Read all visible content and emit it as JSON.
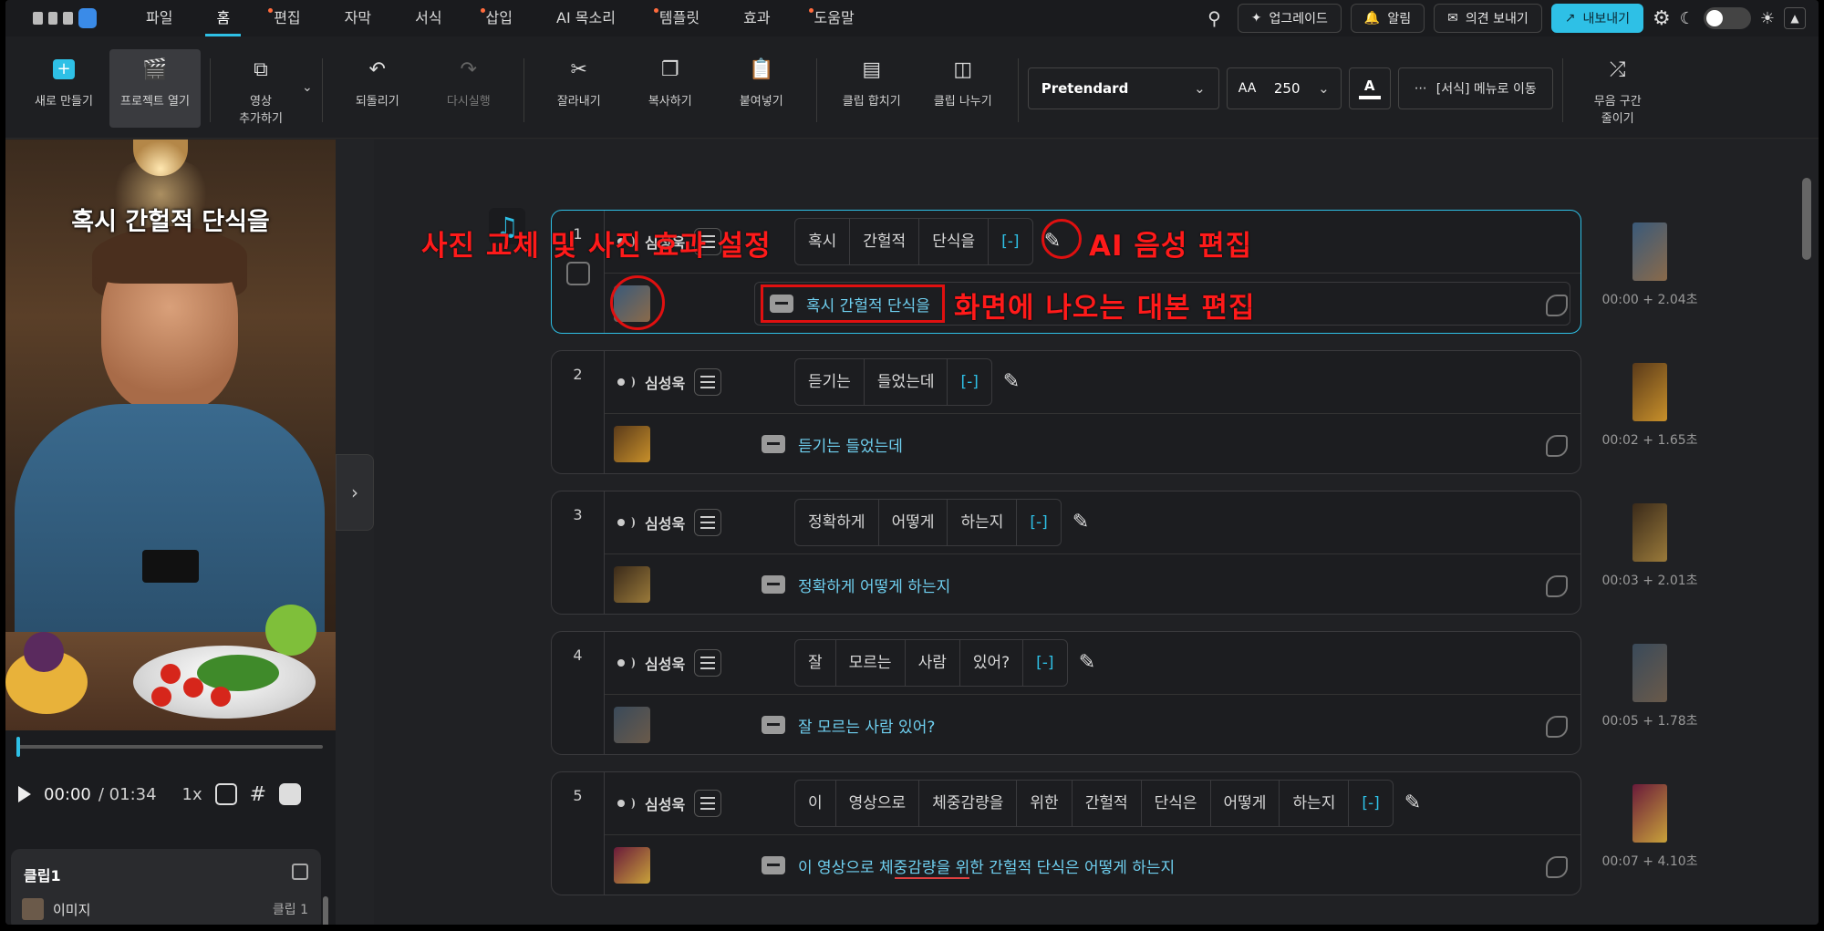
{
  "menu": {
    "items": [
      {
        "label": "파일",
        "dot": false,
        "active": false
      },
      {
        "label": "홈",
        "dot": false,
        "active": true
      },
      {
        "label": "편집",
        "dot": true,
        "active": false
      },
      {
        "label": "자막",
        "dot": false,
        "active": false
      },
      {
        "label": "서식",
        "dot": false,
        "active": false
      },
      {
        "label": "삽입",
        "dot": true,
        "active": false
      },
      {
        "label": "AI 목소리",
        "dot": false,
        "active": false
      },
      {
        "label": "템플릿",
        "dot": true,
        "active": false
      },
      {
        "label": "효과",
        "dot": false,
        "active": false
      },
      {
        "label": "도움말",
        "dot": true,
        "active": false
      }
    ],
    "upgrade": "업그레이드",
    "alerts": "알림",
    "feedback": "의견 보내기",
    "export": "내보내기"
  },
  "toolbar": {
    "new": "새로 만들기",
    "open": "프로젝트 열기",
    "add_video_1": "영상",
    "add_video_2": "추가하기",
    "undo": "되돌리기",
    "redo": "다시실행",
    "cut": "잘라내기",
    "copy": "복사하기",
    "paste": "붙여넣기",
    "merge": "클립 합치기",
    "split": "클립 나누기",
    "font": "Pretendard",
    "font_size": "250",
    "color_letter": "A",
    "format_move": "[서식] 메뉴로 이동",
    "silence_1": "무음 구간",
    "silence_2": "줄이기"
  },
  "preview": {
    "caption": "혹시 간헐적 단식을",
    "time_current": "00:00",
    "time_total": "/ 01:34",
    "speed": "1x",
    "progress": 0.0
  },
  "clip_panel": {
    "title": "클립1",
    "row_label": "이미지",
    "row_value": "클립 1"
  },
  "clips": [
    {
      "num": "1",
      "voice": "심성욱",
      "words": [
        "혹시",
        "간헐적",
        "단식을",
        "[-]"
      ],
      "subtitle": "혹시 간헐적 단식을",
      "timing": "00:00 + 2.04초",
      "selected": true
    },
    {
      "num": "2",
      "voice": "심성욱",
      "words": [
        "듣기는",
        "들었는데",
        "[-]"
      ],
      "subtitle": "듣기는 들었는데",
      "timing": "00:02 + 1.65초",
      "selected": false
    },
    {
      "num": "3",
      "voice": "심성욱",
      "words": [
        "정확하게",
        "어떻게",
        "하는지",
        "[-]"
      ],
      "subtitle": "정확하게 어떻게 하는지",
      "timing": "00:03 + 2.01초",
      "selected": false
    },
    {
      "num": "4",
      "voice": "심성욱",
      "words": [
        "잘",
        "모르는",
        "사람",
        "있어?",
        "[-]"
      ],
      "subtitle": "잘 모르는 사람 있어?",
      "timing": "00:05 + 1.78초",
      "selected": false
    },
    {
      "num": "5",
      "voice": "심성욱",
      "words": [
        "이",
        "영상으로",
        "체중감량을",
        "위한",
        "간헐적",
        "단식은",
        "어떻게",
        "하는지",
        "[-]"
      ],
      "subtitle": "이 영상으로 체중감량을 위한 간헐적 단식은 어떻게 하는지",
      "timing": "00:07 + 4.10초",
      "selected": false
    }
  ],
  "annotations": {
    "photo": "사진 교체 및 사진 효과 설정",
    "voice": "AI 음성 편집",
    "script": "화면에 나오는 대본 편집"
  },
  "colors": {
    "accent": "#2ec0e6",
    "annotation": "#ff1a1a"
  }
}
